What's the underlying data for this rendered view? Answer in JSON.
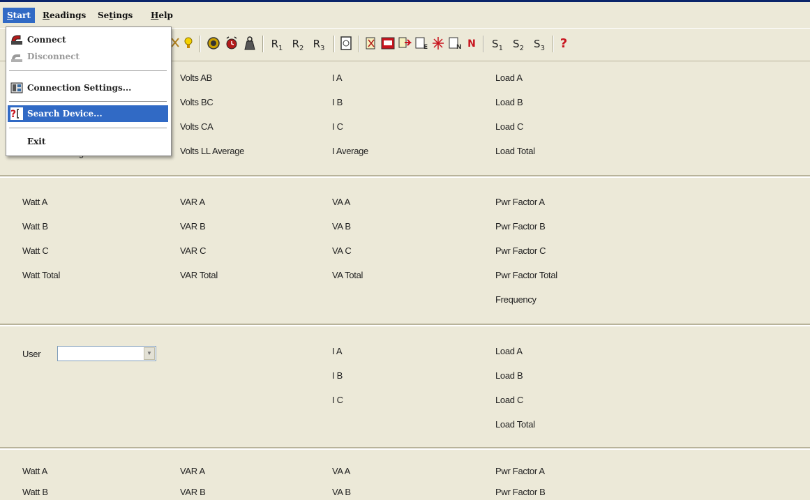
{
  "menubar": {
    "items": [
      "Start",
      "Readings",
      "Settings",
      "Help"
    ],
    "mnemonics": [
      "S",
      "R",
      "t",
      "H"
    ],
    "rest": [
      "tart",
      "eadings",
      "ings",
      "elp"
    ],
    "prefix": [
      "",
      "",
      "Se",
      ""
    ]
  },
  "toolbar": {
    "icons": [
      "lamp-icon",
      "meter-icon",
      "clock-alarm-icon",
      "weight-icon",
      "r1-button",
      "r2-button",
      "r3-button",
      "report-icon",
      "demand-icon",
      "thd-icon",
      "event-arrow-icon",
      "event-e-icon",
      "alarm-icon",
      "event-n-icon",
      "neutral-icon",
      "s1-button",
      "s2-button",
      "s3-button",
      "help-icon"
    ],
    "r1": "R",
    "r2": "R",
    "r3": "R",
    "s1": "S",
    "s2": "S",
    "s3": "S",
    "n_label": "N",
    "help_label": "?",
    "sub1": "1",
    "sub2": "2",
    "sub3": "3"
  },
  "start_menu": {
    "items": [
      {
        "label": "Connect",
        "icon": "connect-icon",
        "enabled": true
      },
      {
        "label": "Disconnect",
        "icon": "disconnect-icon",
        "enabled": false
      },
      {
        "label": "Connection Settings...",
        "icon": "connection-settings-icon",
        "enabled": true
      },
      {
        "label": "Search Device...",
        "icon": "search-device-icon",
        "enabled": true,
        "highlighted": true
      },
      {
        "label": "Exit",
        "icon": "",
        "enabled": true
      }
    ]
  },
  "panel1": {
    "col1": [
      "Volts AB",
      "Volts BC",
      "Volts CA",
      "Volts LL Average"
    ],
    "col2": [
      "I A",
      "I B",
      "I C",
      "I Average"
    ],
    "col3": [
      "Load A",
      "Load B",
      "Load C",
      "Load Total"
    ],
    "hidden_col0_last": "Volts LN Average"
  },
  "panel2": {
    "col0": [
      "Watt A",
      "Watt B",
      "Watt C",
      "Watt Total"
    ],
    "col1": [
      "VAR A",
      "VAR B",
      "VAR C",
      "VAR Total"
    ],
    "col2": [
      "VA A",
      "VA B",
      "VA C",
      "VA Total"
    ],
    "col3": [
      "Pwr Factor A",
      "Pwr Factor B",
      "Pwr Factor C",
      "Pwr Factor Total",
      "Frequency"
    ]
  },
  "panel3": {
    "user_label": "User",
    "user_value": "",
    "col2": [
      "I A",
      "I B",
      "I C"
    ],
    "col3": [
      "Load A",
      "Load B",
      "Load C",
      "Load Total"
    ]
  },
  "panel4": {
    "col0": [
      "Watt A",
      "Watt B"
    ],
    "col1": [
      "VAR A",
      "VAR B"
    ],
    "col2": [
      "VA A",
      "VA B"
    ],
    "col3": [
      "Pwr Factor A",
      "Pwr Factor B"
    ]
  },
  "colors": {
    "menu_highlight": "#316ac5",
    "background": "#ece9d8"
  }
}
